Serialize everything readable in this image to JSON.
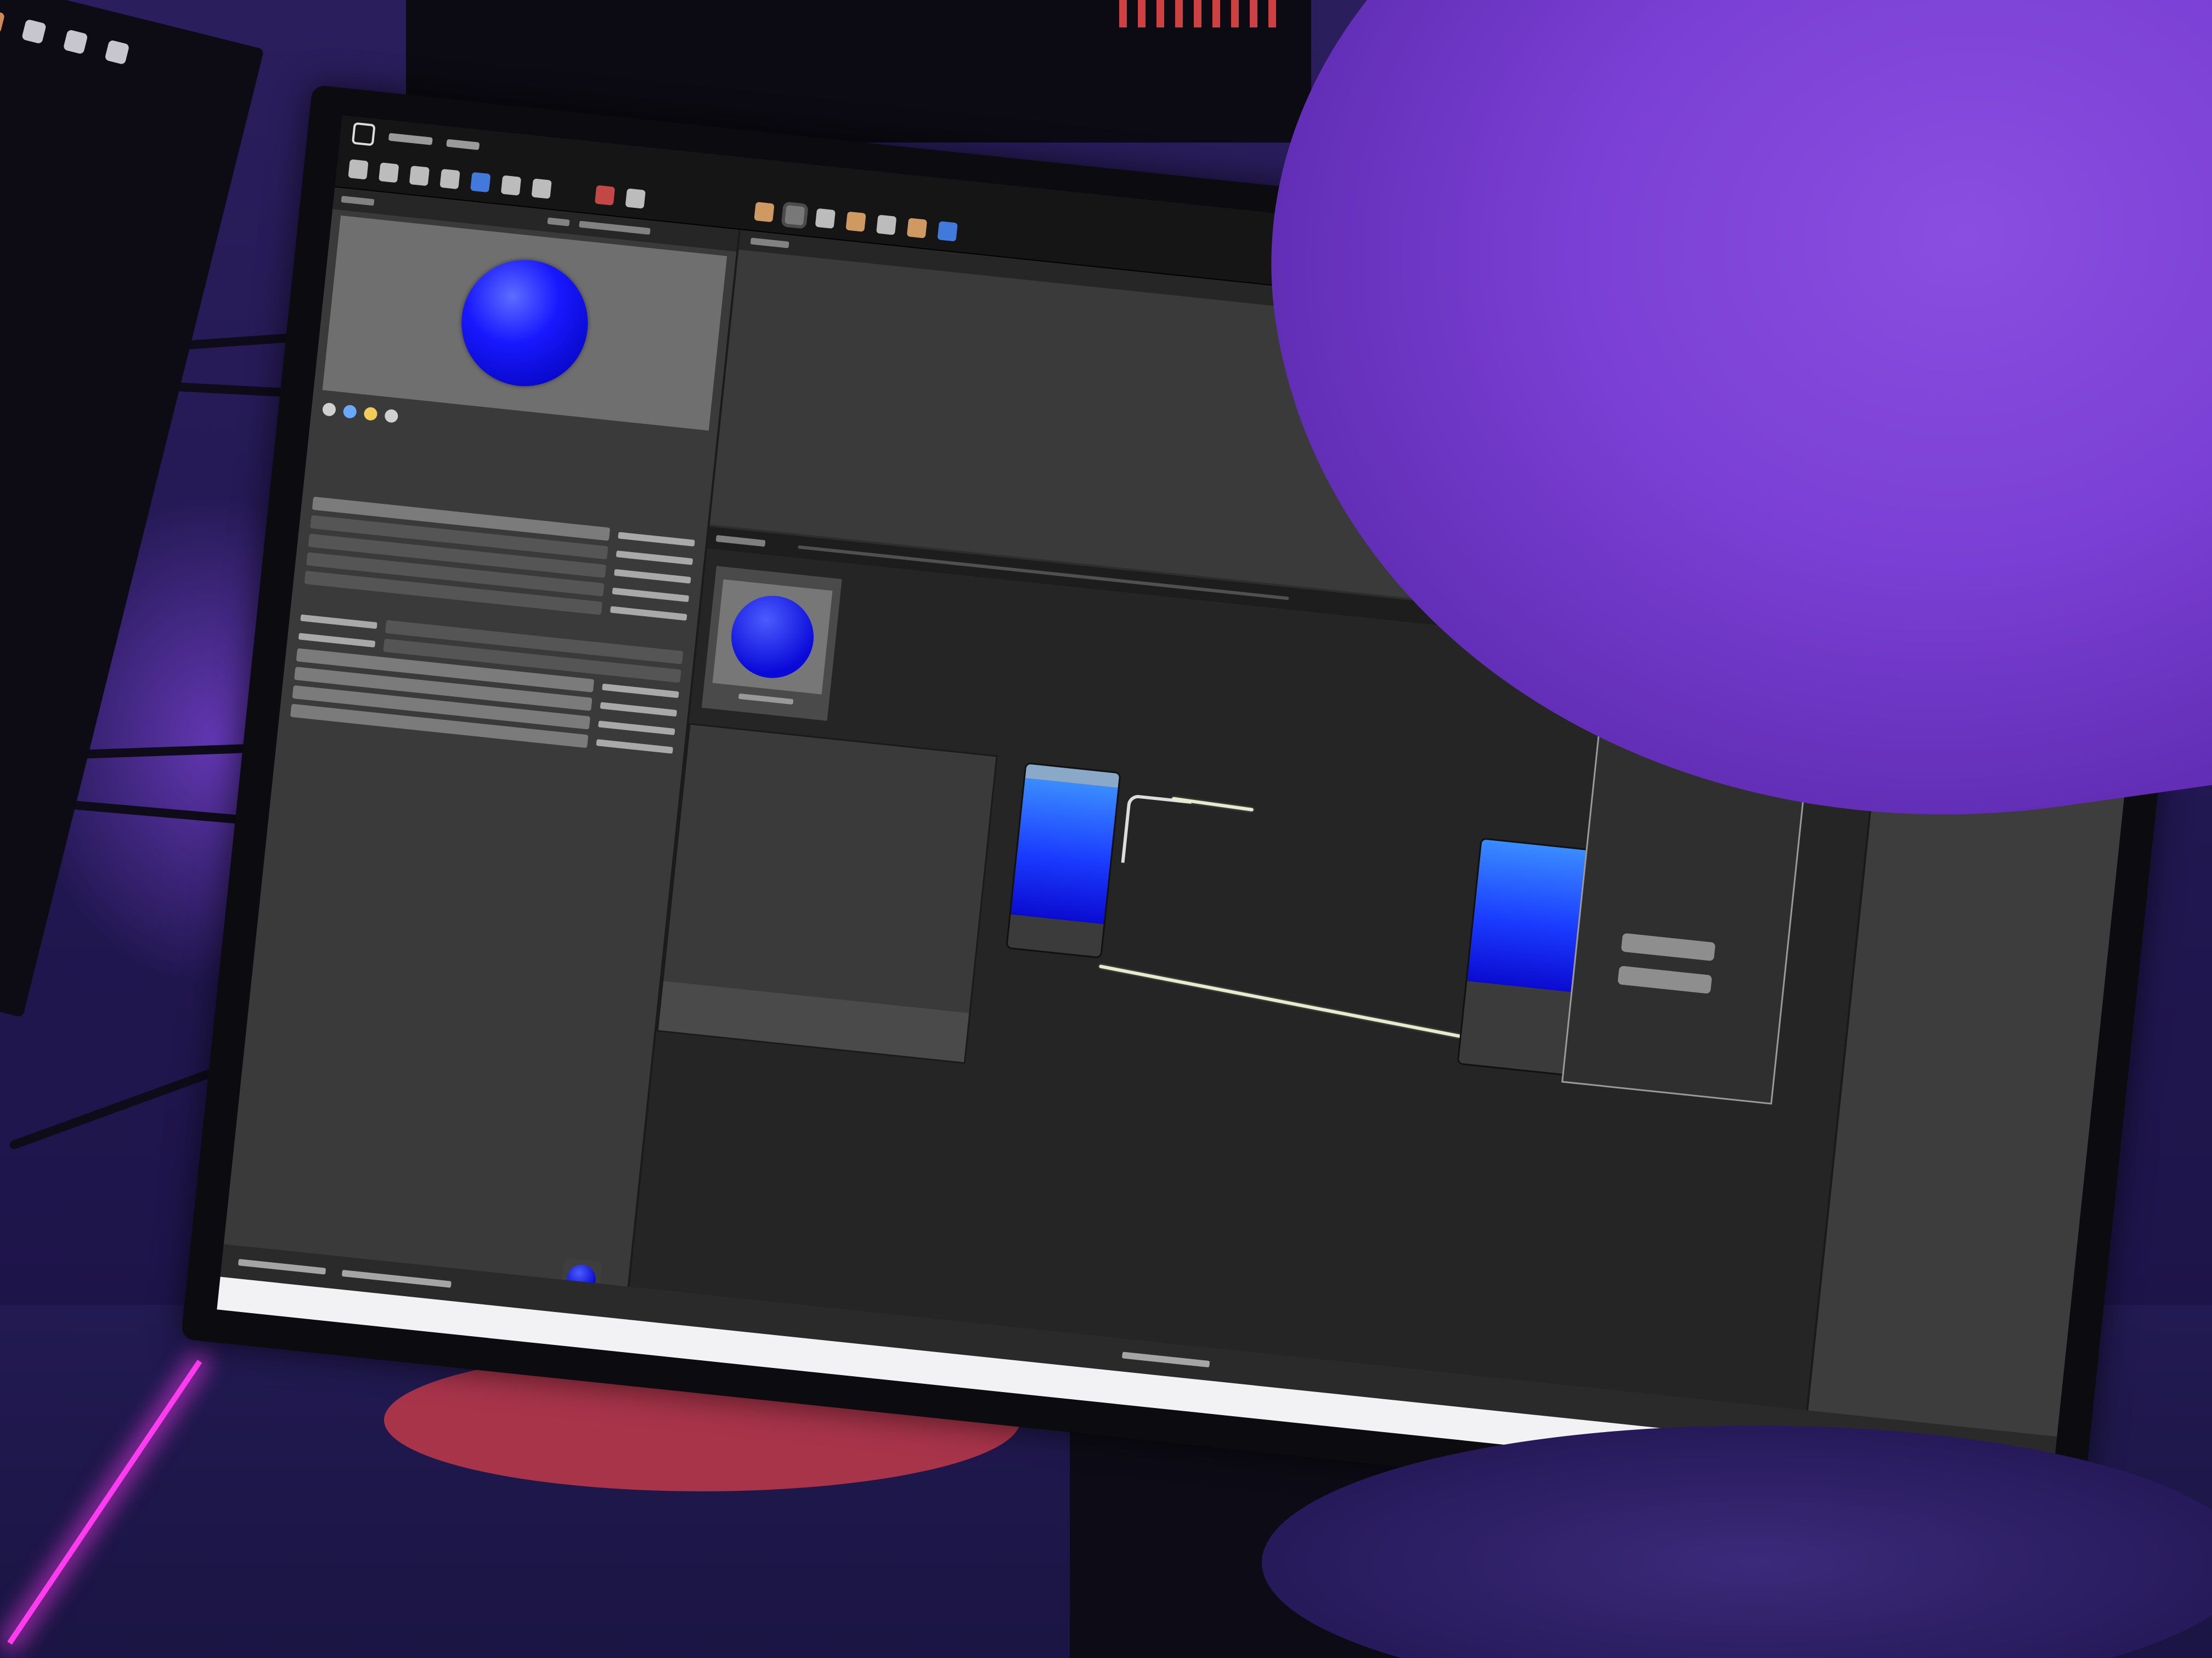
{
  "scene": {
    "description_colors": {
      "wall": "#2a1e5c",
      "purple_cloth": "#7a3fd4",
      "monitor_bezel": "#0c0c10",
      "material_blue": "#0a0ad8",
      "accent_wire": "#e7ecd0",
      "pink_led": "#ff3cf0"
    }
  },
  "screen": {
    "app": "material-editor",
    "toolbar_icons": [
      "save-icon",
      "history-icon",
      "play-icon",
      "settings-icon",
      "texture-icon",
      "fx-icon",
      "scene-icon",
      "light-icon",
      "eye-icon",
      "sphere-icon",
      "bucket-icon",
      "drop-icon",
      "plugin-icon"
    ],
    "assets": [
      {
        "icon": "blue-sphere-asset-icon"
      },
      {
        "icon": "gray-material-asset-icon"
      },
      {
        "icon": "cube-outline-asset-icon"
      },
      {
        "icon": "cube-white-asset-icon"
      },
      {
        "icon": "document-asset-icon"
      }
    ],
    "preview_shape": "sphere"
  }
}
